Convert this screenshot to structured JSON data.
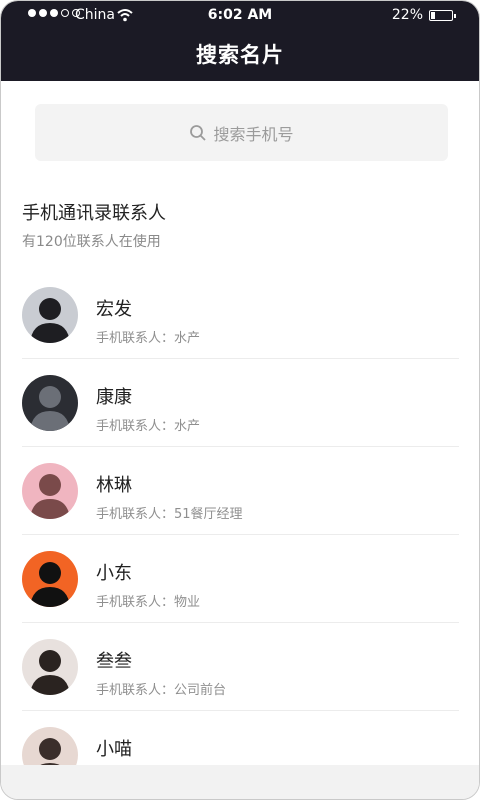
{
  "status_bar": {
    "carrier": "China",
    "time": "6:02 AM",
    "battery_text": "22%",
    "battery_level": 0.22
  },
  "header": {
    "title": "搜索名片"
  },
  "search": {
    "placeholder": "搜索手机号",
    "icon": "search-icon"
  },
  "section": {
    "title": "手机通讯录联系人",
    "subtitle": "有120位联系人在使用"
  },
  "contacts": [
    {
      "name": "宏发",
      "meta": "手机联系人：水产",
      "avatar_colors": [
        "#c9ccd2",
        "#1e1e22"
      ]
    },
    {
      "name": "康康",
      "meta": "手机联系人：水产",
      "avatar_colors": [
        "#2b2d33",
        "#6b6f77"
      ]
    },
    {
      "name": "林琳",
      "meta": "手机联系人：51餐厅经理",
      "avatar_colors": [
        "#f0b5c0",
        "#7a4a4a"
      ]
    },
    {
      "name": "小东",
      "meta": "手机联系人：物业",
      "avatar_colors": [
        "#f26424",
        "#111111"
      ]
    },
    {
      "name": "叁叁",
      "meta": "手机联系人：公司前台",
      "avatar_colors": [
        "#e8e1de",
        "#2a2320"
      ]
    },
    {
      "name": "小喵",
      "meta": "",
      "avatar_colors": [
        "#e7d8d2",
        "#3a2e2b"
      ]
    }
  ]
}
